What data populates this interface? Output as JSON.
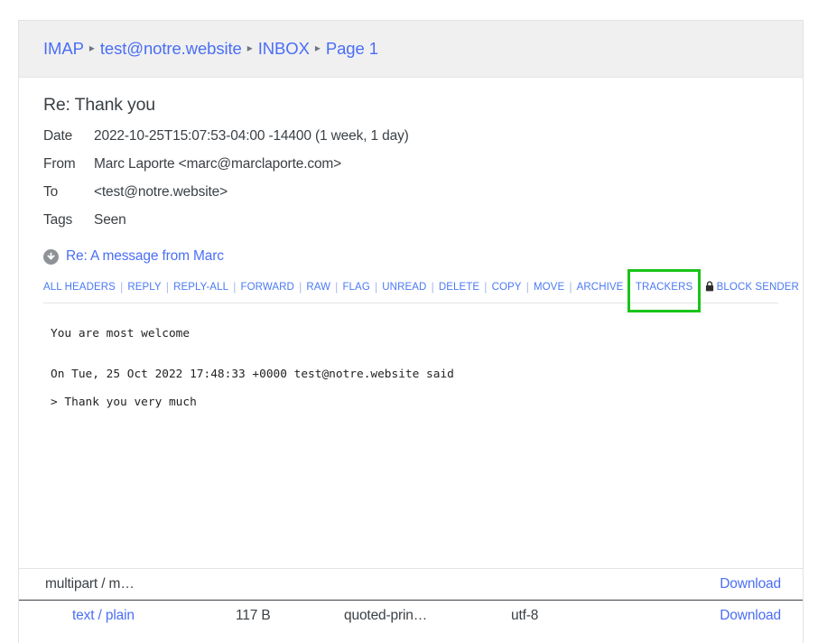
{
  "breadcrumb": {
    "separator": "▸",
    "items": [
      {
        "label": "IMAP"
      },
      {
        "label": "test@notre.website"
      },
      {
        "label": "INBOX"
      },
      {
        "label": "Page 1"
      }
    ]
  },
  "message": {
    "subject": "Re: Thank you",
    "fields": [
      {
        "label": "Date",
        "value": "2022-10-25T15:07:53-04:00 -14400 (1 week, 1 day)"
      },
      {
        "label": "From",
        "value": "Marc Laporte <marc@marclaporte.com>"
      },
      {
        "label": "To",
        "value": "<test@notre.website>"
      },
      {
        "label": "Tags",
        "value": "Seen"
      }
    ],
    "attachment": {
      "icon": "download-circle-icon",
      "label": "Re: A message from Marc"
    },
    "body_paragraphs": [
      "You are most welcome",
      "On Tue, 25 Oct 2022 17:48:33 +0000 test@notre.website said",
      "> Thank you very much"
    ]
  },
  "toolbar": {
    "separator": "|",
    "actions": [
      {
        "label": "ALL HEADERS"
      },
      {
        "label": "REPLY"
      },
      {
        "label": "REPLY-ALL"
      },
      {
        "label": "FORWARD"
      },
      {
        "label": "RAW"
      },
      {
        "label": "FLAG"
      },
      {
        "label": "UNREAD"
      },
      {
        "label": "DELETE"
      },
      {
        "label": "COPY"
      },
      {
        "label": "MOVE"
      },
      {
        "label": "ARCHIVE"
      },
      {
        "label": "TRACKERS"
      },
      {
        "label": "BLOCK SENDER",
        "icon": "lock-icon",
        "icon_glyph": "🔒"
      }
    ],
    "highlight": {
      "target": "TRACKERS",
      "color": "#19c419"
    }
  },
  "parts": {
    "rows": [
      {
        "type": "multipart / m…",
        "size": "",
        "encoding": "",
        "charset": "",
        "download": "Download"
      },
      {
        "type": "text / plain",
        "size": "117 B",
        "encoding": "quoted-prin…",
        "charset": "utf-8",
        "download": "Download"
      }
    ]
  }
}
